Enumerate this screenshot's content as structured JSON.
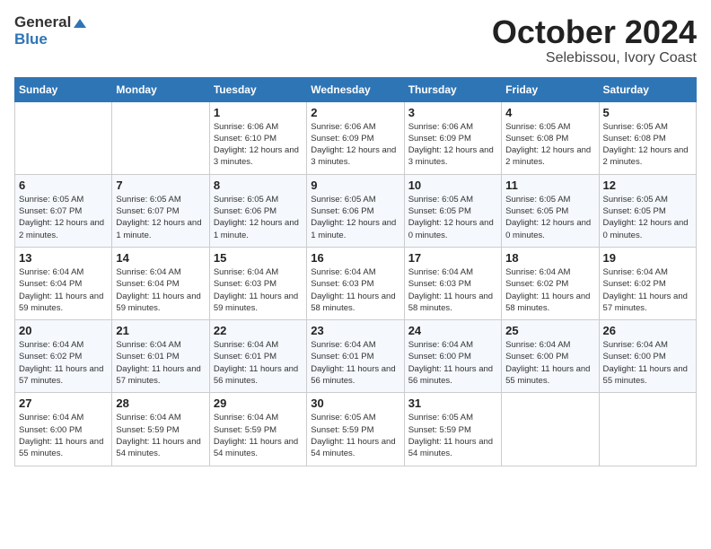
{
  "header": {
    "logo_line1": "General",
    "logo_line2": "Blue",
    "month": "October 2024",
    "location": "Selebissou, Ivory Coast"
  },
  "weekdays": [
    "Sunday",
    "Monday",
    "Tuesday",
    "Wednesday",
    "Thursday",
    "Friday",
    "Saturday"
  ],
  "weeks": [
    [
      {
        "day": "",
        "info": ""
      },
      {
        "day": "",
        "info": ""
      },
      {
        "day": "1",
        "info": "Sunrise: 6:06 AM\nSunset: 6:10 PM\nDaylight: 12 hours and 3 minutes."
      },
      {
        "day": "2",
        "info": "Sunrise: 6:06 AM\nSunset: 6:09 PM\nDaylight: 12 hours and 3 minutes."
      },
      {
        "day": "3",
        "info": "Sunrise: 6:06 AM\nSunset: 6:09 PM\nDaylight: 12 hours and 3 minutes."
      },
      {
        "day": "4",
        "info": "Sunrise: 6:05 AM\nSunset: 6:08 PM\nDaylight: 12 hours and 2 minutes."
      },
      {
        "day": "5",
        "info": "Sunrise: 6:05 AM\nSunset: 6:08 PM\nDaylight: 12 hours and 2 minutes."
      }
    ],
    [
      {
        "day": "6",
        "info": "Sunrise: 6:05 AM\nSunset: 6:07 PM\nDaylight: 12 hours and 2 minutes."
      },
      {
        "day": "7",
        "info": "Sunrise: 6:05 AM\nSunset: 6:07 PM\nDaylight: 12 hours and 1 minute."
      },
      {
        "day": "8",
        "info": "Sunrise: 6:05 AM\nSunset: 6:06 PM\nDaylight: 12 hours and 1 minute."
      },
      {
        "day": "9",
        "info": "Sunrise: 6:05 AM\nSunset: 6:06 PM\nDaylight: 12 hours and 1 minute."
      },
      {
        "day": "10",
        "info": "Sunrise: 6:05 AM\nSunset: 6:05 PM\nDaylight: 12 hours and 0 minutes."
      },
      {
        "day": "11",
        "info": "Sunrise: 6:05 AM\nSunset: 6:05 PM\nDaylight: 12 hours and 0 minutes."
      },
      {
        "day": "12",
        "info": "Sunrise: 6:05 AM\nSunset: 6:05 PM\nDaylight: 12 hours and 0 minutes."
      }
    ],
    [
      {
        "day": "13",
        "info": "Sunrise: 6:04 AM\nSunset: 6:04 PM\nDaylight: 11 hours and 59 minutes."
      },
      {
        "day": "14",
        "info": "Sunrise: 6:04 AM\nSunset: 6:04 PM\nDaylight: 11 hours and 59 minutes."
      },
      {
        "day": "15",
        "info": "Sunrise: 6:04 AM\nSunset: 6:03 PM\nDaylight: 11 hours and 59 minutes."
      },
      {
        "day": "16",
        "info": "Sunrise: 6:04 AM\nSunset: 6:03 PM\nDaylight: 11 hours and 58 minutes."
      },
      {
        "day": "17",
        "info": "Sunrise: 6:04 AM\nSunset: 6:03 PM\nDaylight: 11 hours and 58 minutes."
      },
      {
        "day": "18",
        "info": "Sunrise: 6:04 AM\nSunset: 6:02 PM\nDaylight: 11 hours and 58 minutes."
      },
      {
        "day": "19",
        "info": "Sunrise: 6:04 AM\nSunset: 6:02 PM\nDaylight: 11 hours and 57 minutes."
      }
    ],
    [
      {
        "day": "20",
        "info": "Sunrise: 6:04 AM\nSunset: 6:02 PM\nDaylight: 11 hours and 57 minutes."
      },
      {
        "day": "21",
        "info": "Sunrise: 6:04 AM\nSunset: 6:01 PM\nDaylight: 11 hours and 57 minutes."
      },
      {
        "day": "22",
        "info": "Sunrise: 6:04 AM\nSunset: 6:01 PM\nDaylight: 11 hours and 56 minutes."
      },
      {
        "day": "23",
        "info": "Sunrise: 6:04 AM\nSunset: 6:01 PM\nDaylight: 11 hours and 56 minutes."
      },
      {
        "day": "24",
        "info": "Sunrise: 6:04 AM\nSunset: 6:00 PM\nDaylight: 11 hours and 56 minutes."
      },
      {
        "day": "25",
        "info": "Sunrise: 6:04 AM\nSunset: 6:00 PM\nDaylight: 11 hours and 55 minutes."
      },
      {
        "day": "26",
        "info": "Sunrise: 6:04 AM\nSunset: 6:00 PM\nDaylight: 11 hours and 55 minutes."
      }
    ],
    [
      {
        "day": "27",
        "info": "Sunrise: 6:04 AM\nSunset: 6:00 PM\nDaylight: 11 hours and 55 minutes."
      },
      {
        "day": "28",
        "info": "Sunrise: 6:04 AM\nSunset: 5:59 PM\nDaylight: 11 hours and 54 minutes."
      },
      {
        "day": "29",
        "info": "Sunrise: 6:04 AM\nSunset: 5:59 PM\nDaylight: 11 hours and 54 minutes."
      },
      {
        "day": "30",
        "info": "Sunrise: 6:05 AM\nSunset: 5:59 PM\nDaylight: 11 hours and 54 minutes."
      },
      {
        "day": "31",
        "info": "Sunrise: 6:05 AM\nSunset: 5:59 PM\nDaylight: 11 hours and 54 minutes."
      },
      {
        "day": "",
        "info": ""
      },
      {
        "day": "",
        "info": ""
      }
    ]
  ]
}
